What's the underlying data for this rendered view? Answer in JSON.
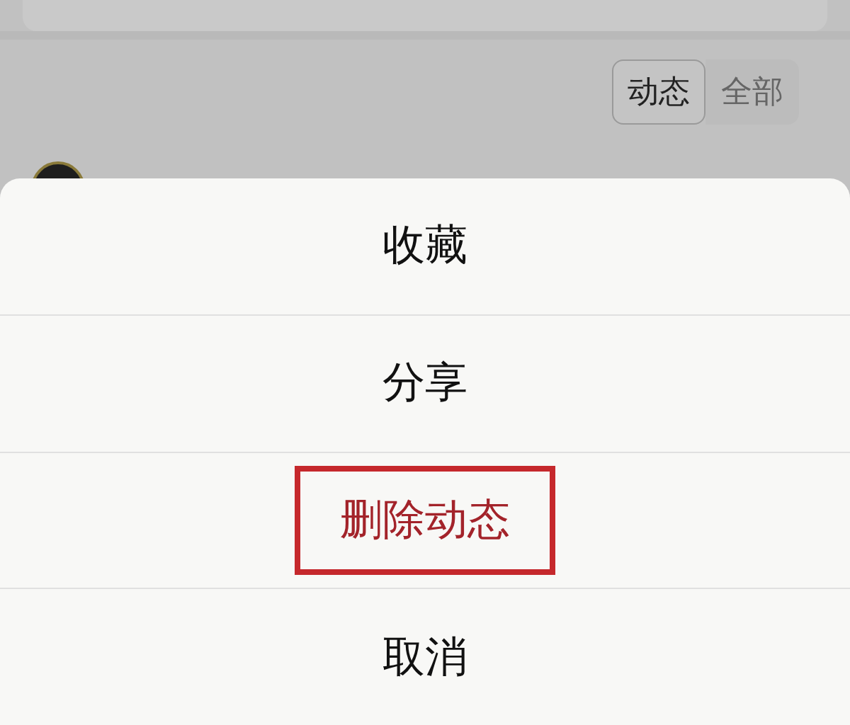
{
  "filter_tabs": [
    {
      "label": "动态",
      "selected": true
    },
    {
      "label": "全部",
      "selected": false
    }
  ],
  "action_sheet": {
    "items": [
      {
        "label": "收藏",
        "kind": "normal",
        "highlighted": false
      },
      {
        "label": "分享",
        "kind": "normal",
        "highlighted": false
      },
      {
        "label": "删除动态",
        "kind": "destructive",
        "highlighted": true
      },
      {
        "label": "取消",
        "kind": "normal",
        "highlighted": false
      }
    ]
  }
}
